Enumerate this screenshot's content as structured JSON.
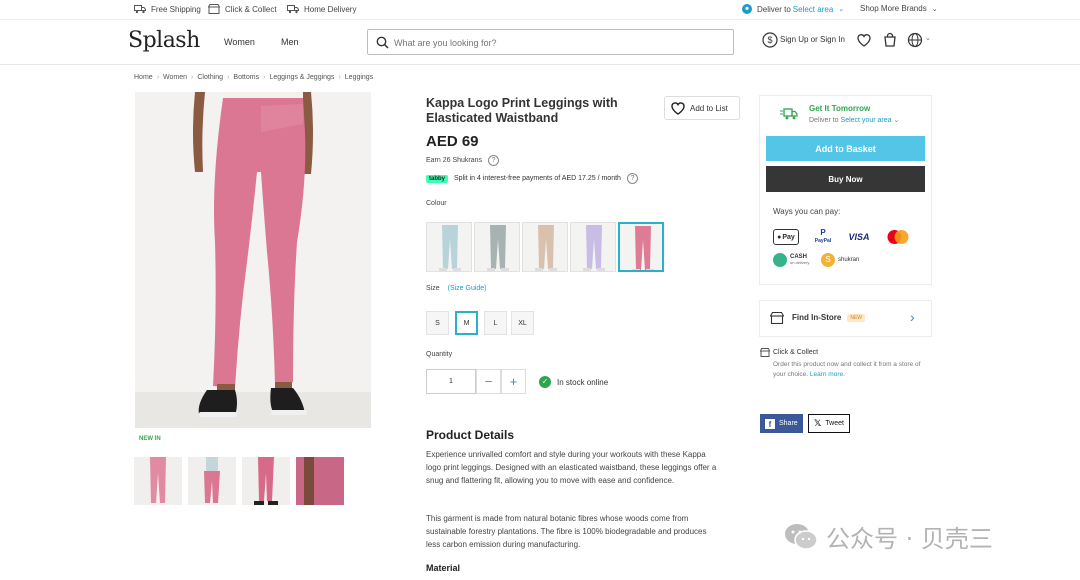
{
  "topbar": {
    "free_shipping": "Free Shipping",
    "click_collect": "Click & Collect",
    "home_delivery": "Home Delivery",
    "deliver_to": "Deliver to",
    "select_area": "Select area",
    "shop_more": "Shop More Brands"
  },
  "header": {
    "logo": "Splash",
    "nav": [
      "Women",
      "Men"
    ],
    "search_placeholder": "What are you looking for?",
    "signin": "Sign Up or Sign In"
  },
  "breadcrumb": [
    "Home",
    "Women",
    "Clothing",
    "Bottoms",
    "Leggings & Jeggings",
    "Leggings"
  ],
  "product": {
    "title": "Kappa Logo Print Leggings with Elasticated Waistband",
    "add_to_list": "Add to List",
    "price": "AED 69",
    "shukrans": "Earn 26 Shukrans",
    "tabby_badge": "tabby",
    "tabby_text": "Split in 4 interest-free payments of AED 17.25 / month",
    "colour_label": "Colour",
    "colours": [
      "#b9d3da",
      "#a7b2b3",
      "#d8c2ad",
      "#c9bde6",
      "#df7c95"
    ],
    "selected_colour_index": 4,
    "size_label": "Size",
    "size_guide": "(Size Guide)",
    "sizes": [
      "S",
      "M",
      "L",
      "XL"
    ],
    "selected_size": "M",
    "quantity_label": "Quantity",
    "quantity": "1",
    "stock": "In stock online",
    "new_in": "NEW IN",
    "legging_color": "#db7793"
  },
  "details": {
    "title": "Product Details",
    "para1": "Experience unrivalled comfort and style during your workouts with these Kappa logo print leggings. Designed with an elasticated waistband, these leggings offer a snug and flattering fit, allowing you to move with ease and confidence.",
    "para2": "This garment is made from natural botanic fibres whose woods come from sustainable forestry plantations. The fibre is 100% biodegradable and produces less carbon emission during manufacturing.",
    "material": "Material"
  },
  "panel": {
    "get_it": "Get It Tomorrow",
    "deliver_to": "Deliver to",
    "select_your_area": "Select your area",
    "add_basket": "Add to Basket",
    "buy_now": "Buy Now",
    "ways_to_pay": "Ways you can pay:",
    "pay_apple": "Pay",
    "pay_paypal": "PayPal",
    "pay_visa": "VISA",
    "pay_cash": "CASH",
    "pay_cash_sub": "on delivery",
    "pay_shukran": "shukran",
    "find_store": "Find In-Store",
    "new_tag": "NEW",
    "cc_title": "Click & Collect",
    "cc_text": "Order this product now and collect it from a store of your choice.",
    "learn_more": "Learn more.",
    "share": "Share",
    "tweet": "Tweet"
  },
  "watermark": {
    "text": "公众号 · 贝壳三"
  }
}
